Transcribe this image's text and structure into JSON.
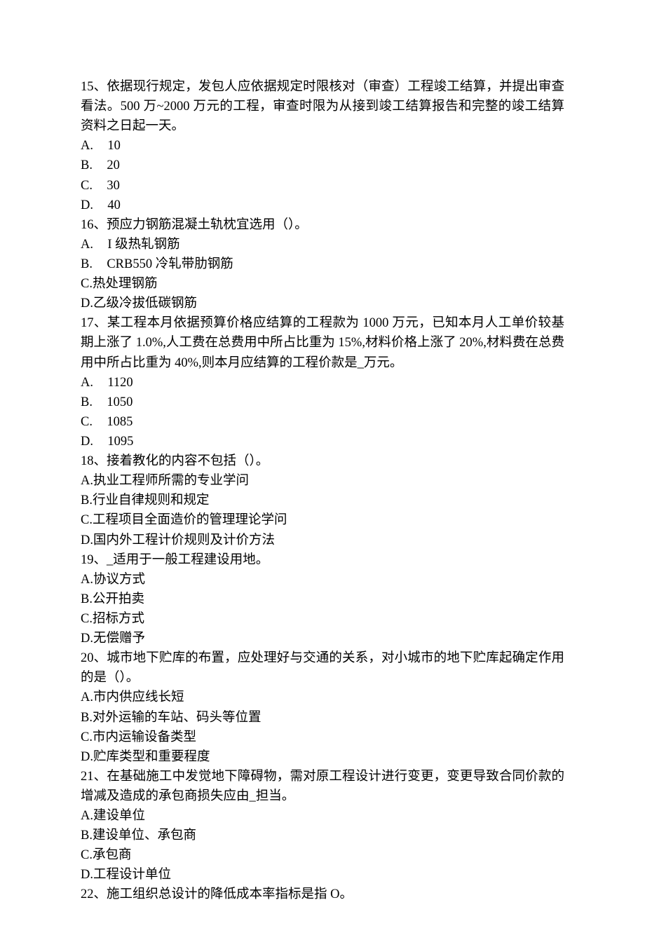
{
  "questions": [
    {
      "number": "15、",
      "stem": "依据现行规定，发包人应依据规定时限核对（审查）工程竣工结算，并提出审查看法。500 万~2000 万元的工程，审查时限为从接到竣工结算报告和完整的竣工结算资料之日起一天。",
      "options": [
        {
          "letter": "A.",
          "text": "10",
          "gap": true
        },
        {
          "letter": "B.",
          "text": "20",
          "gap": true
        },
        {
          "letter": "C.",
          "text": "30",
          "gap": true
        },
        {
          "letter": "D.",
          "text": "40",
          "gap": true
        }
      ]
    },
    {
      "number": "16、",
      "stem": "预应力钢筋混凝土轨枕宜选用（）。",
      "options": [
        {
          "letter": "A.",
          "text": "I 级热轧钢筋",
          "gap": true
        },
        {
          "letter": "B.",
          "text": "CRB550 冷轧带肋钢筋",
          "gap": true
        },
        {
          "letter": "C.",
          "text": "热处理钢筋",
          "gap": false
        },
        {
          "letter": "D.",
          "text": "乙级冷拔低碳钢筋",
          "gap": false
        }
      ]
    },
    {
      "number": "17、",
      "stem": "某工程本月依据预算价格应结算的工程款为 1000 万元，已知本月人工单价较基期上涨了 1.0%,人工费在总费用中所占比重为 15%,材料价格上涨了 20%,材料费在总费用中所占比重为 40%,则本月应结算的工程价款是_万元。",
      "options": [
        {
          "letter": "A.",
          "text": "1120",
          "gap": true
        },
        {
          "letter": "B.",
          "text": "1050",
          "gap": true
        },
        {
          "letter": "C.",
          "text": "1085",
          "gap": true
        },
        {
          "letter": "D.",
          "text": "1095",
          "gap": true
        }
      ]
    },
    {
      "number": "18、",
      "stem": "接着教化的内容不包括（）。",
      "options": [
        {
          "letter": "A.",
          "text": "执业工程师所需的专业学问",
          "gap": false
        },
        {
          "letter": "B.",
          "text": "行业自律规则和规定",
          "gap": false
        },
        {
          "letter": "C.",
          "text": "工程项目全面造价的管理理论学问",
          "gap": false
        },
        {
          "letter": "D.",
          "text": "国内外工程计价规则及计价方法",
          "gap": false
        }
      ]
    },
    {
      "number": "19、",
      "stem": "_适用于一般工程建设用地。",
      "options": [
        {
          "letter": "A.",
          "text": "协议方式",
          "gap": false
        },
        {
          "letter": "B.",
          "text": "公开拍卖",
          "gap": false
        },
        {
          "letter": "C.",
          "text": "招标方式",
          "gap": false
        },
        {
          "letter": "D.",
          "text": "无偿赠予",
          "gap": false
        }
      ]
    },
    {
      "number": "20、",
      "stem": "城市地下贮库的布置，应处理好与交通的关系，对小城市的地下贮库起确定作用的是（）。",
      "options": [
        {
          "letter": "A.",
          "text": "市内供应线长短",
          "gap": false
        },
        {
          "letter": "B.",
          "text": "对外运输的车站、码头等位置",
          "gap": false
        },
        {
          "letter": "C.",
          "text": "市内运输设备类型",
          "gap": false
        },
        {
          "letter": "D.",
          "text": "贮库类型和重要程度",
          "gap": false
        }
      ]
    },
    {
      "number": "21、",
      "stem": "在基础施工中发觉地下障碍物，需对原工程设计进行变更，变更导致合同价款的增减及造成的承包商损失应由_担当。",
      "options": [
        {
          "letter": "A.",
          "text": "建设单位",
          "gap": false
        },
        {
          "letter": "B.",
          "text": "建设单位、承包商",
          "gap": false
        },
        {
          "letter": "C.",
          "text": "承包商",
          "gap": false
        },
        {
          "letter": "D.",
          "text": "工程设计单位",
          "gap": false
        }
      ]
    },
    {
      "number": "22、",
      "stem": "施工组织总设计的降低成本率指标是指 O。",
      "options": []
    }
  ]
}
